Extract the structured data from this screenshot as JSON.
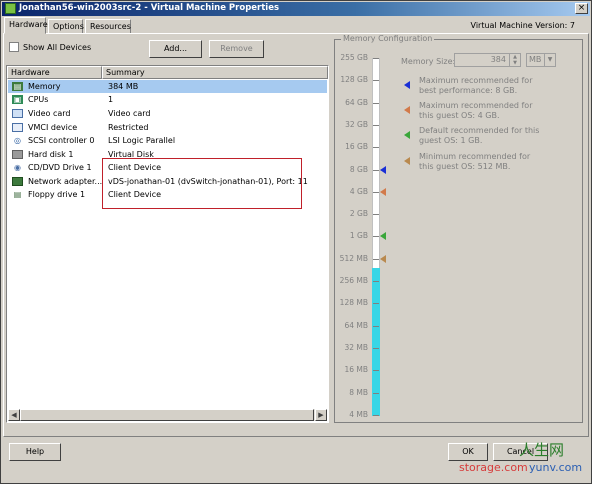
{
  "window": {
    "title": "Jonathan56-win2003src-2 - Virtual Machine Properties",
    "version_text": "Virtual Machine Version: 7",
    "close_glyph": "×"
  },
  "tabs": [
    {
      "label": "Hardware",
      "active": true
    },
    {
      "label": "Options",
      "active": false
    },
    {
      "label": "Resources",
      "active": false
    }
  ],
  "toolbar": {
    "show_all_label": "Show All Devices",
    "show_all_checked": false,
    "add_label": "Add...",
    "remove_label": "Remove"
  },
  "hardware_table": {
    "columns": [
      "Hardware",
      "Summary"
    ],
    "rows": [
      {
        "name": "Memory",
        "summary": "384 MB",
        "icon": "memory-icon",
        "selected": true
      },
      {
        "name": "CPUs",
        "summary": "1",
        "icon": "cpu-icon",
        "selected": false
      },
      {
        "name": "Video card",
        "summary": "Video card",
        "icon": "monitor-icon",
        "selected": false
      },
      {
        "name": "VMCI device",
        "summary": "Restricted",
        "icon": "vmci-icon",
        "selected": false
      },
      {
        "name": "SCSI controller 0",
        "summary": "LSI Logic Parallel",
        "icon": "scsi-icon",
        "selected": false
      },
      {
        "name": "Hard disk 1",
        "summary": "Virtual Disk",
        "icon": "hard-disk-icon",
        "selected": false
      },
      {
        "name": "CD/DVD Drive 1",
        "summary": "Client Device",
        "icon": "cd-dvd-icon",
        "selected": false
      },
      {
        "name": "Network adapter...",
        "summary": "vDS-jonathan-01 (dvSwitch-jonathan-01), Port: 11",
        "icon": "network-adapter-icon",
        "selected": false
      },
      {
        "name": "Floppy drive 1",
        "summary": "Client Device",
        "icon": "floppy-icon",
        "selected": false
      }
    ]
  },
  "memory_config": {
    "group_title": "Memory Configuration",
    "size_label": "Memory Size:",
    "size_value": "384",
    "unit": "MB",
    "scale_labels": [
      "255 GB",
      "128 GB",
      "64 GB",
      "32 GB",
      "16 GB",
      "8 GB",
      "4 GB",
      "2 GB",
      "1 GB",
      "512 MB",
      "256 MB",
      "128 MB",
      "64 MB",
      "32 MB",
      "16 MB",
      "8 MB",
      "4 MB"
    ],
    "current_mb": 384,
    "markers": [
      {
        "label": "Maximum recommended for best performance: 8 GB.",
        "value": "8 GB",
        "color": "#1a2fd6"
      },
      {
        "label": "Maximum recommended for this guest OS: 4 GB.",
        "value": "4 GB",
        "color": "#d27a4a"
      },
      {
        "label": "Default recommended for this guest OS: 1 GB.",
        "value": "1 GB",
        "color": "#3aa63a"
      },
      {
        "label": "Minimum recommended for this guest OS: 512 MB.",
        "value": "512 MB",
        "color": "#b9894e"
      }
    ]
  },
  "footer": {
    "help_label": "Help",
    "ok_label": "OK",
    "cancel_label": "Cancel"
  },
  "watermarks": [
    "人生网",
    "storage.com",
    "yunv.com"
  ],
  "colors": {
    "selection": "#a6caf0",
    "highlight_box": "#c0202a",
    "memory_fill": "#38d6e6"
  }
}
